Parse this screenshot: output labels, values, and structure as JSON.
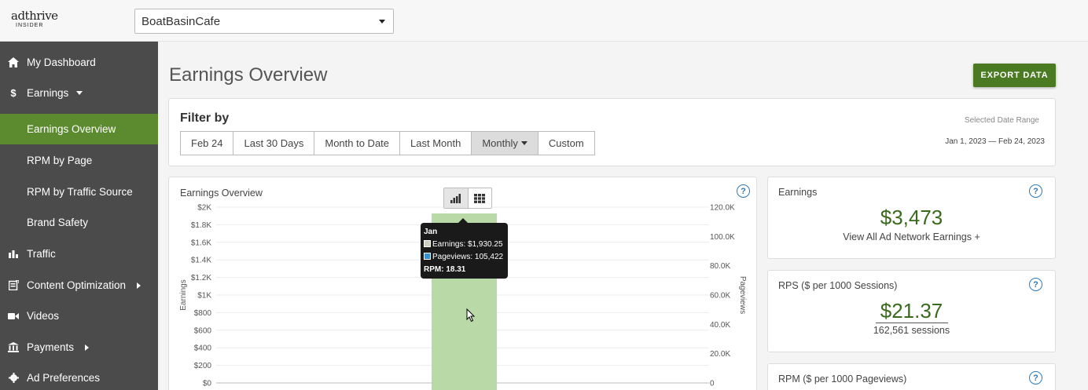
{
  "logo": {
    "brand": "adthrive",
    "sub": "INSIDER"
  },
  "site_selector": {
    "value": "BoatBasinCafe"
  },
  "sidebar": {
    "items": [
      {
        "label": "My Dashboard",
        "icon": "home-icon"
      },
      {
        "label": "Earnings",
        "icon": "dollar-icon"
      },
      {
        "label": "Earnings Overview"
      },
      {
        "label": "RPM by Page"
      },
      {
        "label": "RPM by Traffic Source"
      },
      {
        "label": "Brand Safety"
      },
      {
        "label": "Traffic",
        "icon": "bar-chart-icon"
      },
      {
        "label": "Content Optimization",
        "icon": "content-icon"
      },
      {
        "label": "Videos",
        "icon": "video-icon"
      },
      {
        "label": "Payments",
        "icon": "bank-icon"
      },
      {
        "label": "Ad Preferences",
        "icon": "gear-icon"
      }
    ]
  },
  "page": {
    "title": "Earnings Overview",
    "export_label": "EXPORT DATA"
  },
  "filter": {
    "title": "Filter by",
    "buttons": [
      "Feb 24",
      "Last 30 Days",
      "Month to Date",
      "Last Month",
      "Monthly",
      "Custom"
    ],
    "selected": "Monthly",
    "range_label": "Selected Date Range",
    "range_value": "Jan 1, 2023 — Feb 24, 2023"
  },
  "chart_card": {
    "title": "Earnings Overview",
    "tooltip": {
      "title": "Jan",
      "earnings": "Earnings: $1,930.25",
      "pageviews": "Pageviews: 105,422",
      "rpm": "RPM: 18.31"
    }
  },
  "chart_data": {
    "type": "bar",
    "categories": [
      "Jan"
    ],
    "series": [
      {
        "name": "Earnings",
        "values": [
          1930.25
        ],
        "axis": "left",
        "color": "#b9d9a6"
      },
      {
        "name": "Pageviews",
        "values": [
          105422
        ],
        "axis": "right",
        "color": "#3a8fd0"
      }
    ],
    "ylabel": "Earnings",
    "y2label": "Pageviews",
    "ylim": [
      0,
      2000
    ],
    "y2lim": [
      0,
      120000
    ],
    "yticks": [
      "$0",
      "$200",
      "$400",
      "$600",
      "$800",
      "$1K",
      "$1.2K",
      "$1.4K",
      "$1.6K",
      "$1.8K",
      "$2K"
    ],
    "y2ticks": [
      "0",
      "20.0K",
      "40.0K",
      "60.0K",
      "80.0K",
      "100.0K",
      "120.0K"
    ],
    "grid": true
  },
  "stats": {
    "earnings": {
      "label": "Earnings",
      "value": "$3,473",
      "link": "View All Ad Network Earnings +"
    },
    "rps": {
      "label": "RPS ($ per 1000 Sessions)",
      "value": "$21.37",
      "sub": "162,561 sessions"
    },
    "rpm": {
      "label": "RPM ($ per 1000 Pageviews)"
    }
  },
  "colors": {
    "accent": "#5c8a2e",
    "button": "#4a7b23",
    "value": "#3a6b1d",
    "sidebar": "#4b4b4b",
    "help": "#2e7ab8"
  }
}
